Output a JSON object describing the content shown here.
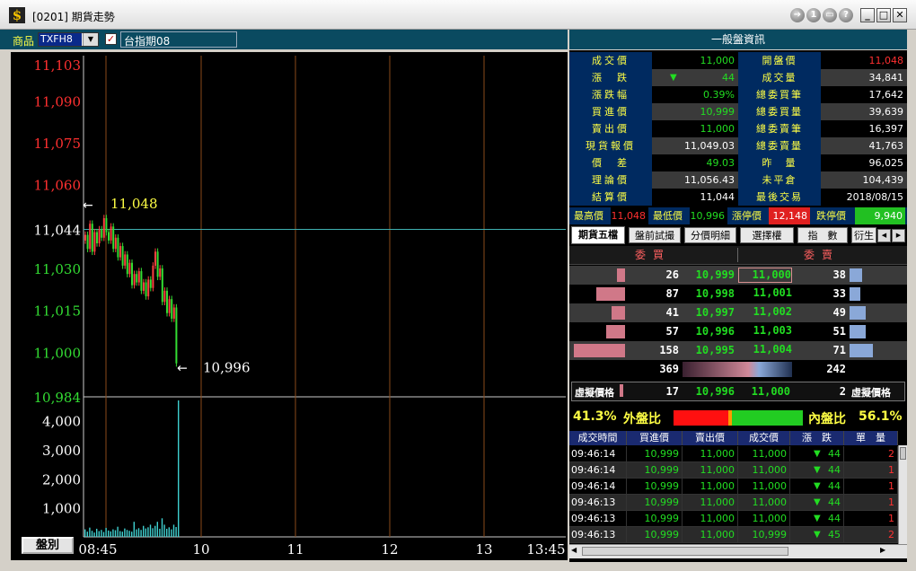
{
  "window": {
    "title": "[0201] 期貨走勢",
    "app_icon_glyph": "$"
  },
  "title_buttons": {
    "help_label": "?",
    "info_label": "1",
    "minimize_label": "_",
    "maximize_label": "□",
    "close_label": "✕"
  },
  "toolbar": {
    "product_label": "商品",
    "product_code": "TXFH8",
    "product_name": "台指期08",
    "panel_title": "一般盤資訊"
  },
  "chart": {
    "price_ticks": [
      "11,103",
      "11,090",
      "11,075",
      "11,060",
      "11,044",
      "11,030",
      "11,015",
      "11,000",
      "10,984"
    ],
    "price_tick_values": [
      11103,
      11090,
      11075,
      11060,
      11044,
      11030,
      11015,
      11000,
      10984
    ],
    "price_tick_colors": [
      "#ff3030",
      "#ff3030",
      "#ff3030",
      "#ff3030",
      "#ffffff",
      "#33dd33",
      "#33dd33",
      "#33dd33",
      "#33dd33"
    ],
    "reference_price": 11044,
    "high_annotation": "11,048",
    "low_annotation": "10,996",
    "high_price": 11048,
    "low_price": 10996,
    "volume_ticks": [
      "4,000",
      "3,000",
      "2,000",
      "1,000"
    ],
    "volume_tick_values": [
      4000,
      3000,
      2000,
      1000
    ],
    "time_ticks": [
      "08:45",
      "10",
      "11",
      "12",
      "13",
      "13:45"
    ],
    "fraction_button": "盤別"
  },
  "quote": {
    "rows": [
      {
        "l1": "成交價",
        "v1": "11,000",
        "c1": "#22dd22",
        "l2": "開盤價",
        "v2": "11,048",
        "c2": "#ff3030"
      },
      {
        "l1": "漲　跌",
        "v1": "44",
        "c1": "#22dd22",
        "l2": "成交量",
        "v2": "34,841",
        "c2": "#ffffff"
      },
      {
        "l1": "漲跌幅",
        "v1": "0.39%",
        "c1": "#22dd22",
        "l2": "總委買筆",
        "v2": "17,642",
        "c2": "#ffffff"
      },
      {
        "l1": "買進價",
        "v1": "10,999",
        "c1": "#22dd22",
        "l2": "總委買量",
        "v2": "39,639",
        "c2": "#ffffff"
      },
      {
        "l1": "賣出價",
        "v1": "11,000",
        "c1": "#22dd22",
        "l2": "總委賣筆",
        "v2": "16,397",
        "c2": "#ffffff"
      },
      {
        "l1": "現貨報價",
        "v1": "11,049.03",
        "c1": "#ffffff",
        "l2": "總委賣量",
        "v2": "41,763",
        "c2": "#ffffff"
      },
      {
        "l1": "價　差",
        "v1": "49.03",
        "c1": "#22dd22",
        "l2": "昨　量",
        "v2": "96,025",
        "c2": "#ffffff"
      },
      {
        "l1": "理論價",
        "v1": "11,056.43",
        "c1": "#ffffff",
        "l2": "未平倉",
        "v2": "104,439",
        "c2": "#ffffff"
      },
      {
        "l1": "結算價",
        "v1": "11,044",
        "c1": "#ffffff",
        "l2": "最後交易",
        "v2": "2018/08/15",
        "c2": "#ffffff"
      }
    ],
    "change_arrow": "▼"
  },
  "limits": {
    "high_label": "最高價",
    "high_value": "11,048",
    "low_label": "最低價",
    "low_value": "10,996",
    "up_label": "漲停價",
    "up_value": "12,148",
    "down_label": "跌停價",
    "down_value": "9,940"
  },
  "tabs": [
    {
      "label": "期貨五檔"
    },
    {
      "label": "盤前試撮"
    },
    {
      "label": "分價明細"
    },
    {
      "label": "選擇權"
    },
    {
      "label": "指　數"
    },
    {
      "label": "衍生"
    }
  ],
  "book": {
    "bid_header": "委買",
    "ask_header": "委賣",
    "levels": [
      {
        "bid_qty": "26",
        "bid": "10,999",
        "ask": "11,000",
        "ask_qty": "38",
        "bid_n": 26,
        "ask_n": 38
      },
      {
        "bid_qty": "87",
        "bid": "10,998",
        "ask": "11,001",
        "ask_qty": "33",
        "bid_n": 87,
        "ask_n": 33
      },
      {
        "bid_qty": "41",
        "bid": "10,997",
        "ask": "11,002",
        "ask_qty": "49",
        "bid_n": 41,
        "ask_n": 49
      },
      {
        "bid_qty": "57",
        "bid": "10,996",
        "ask": "11,003",
        "ask_qty": "51",
        "bid_n": 57,
        "ask_n": 51
      },
      {
        "bid_qty": "158",
        "bid": "10,995",
        "ask": "11,004",
        "ask_qty": "71",
        "bid_n": 158,
        "ask_n": 71
      }
    ],
    "bid_total": "369",
    "ask_total": "242",
    "sim_label_left": "虛擬價格",
    "sim_bid_qty": "17",
    "sim_bid": "10,996",
    "sim_ask": "11,000",
    "sim_ask_qty": "2",
    "sim_label_right": "虛擬價格"
  },
  "ratio": {
    "outer_pct": "41.3%",
    "outer_label": "外盤比",
    "inner_label": "內盤比",
    "inner_pct": "56.1%",
    "outer_value": 41.3,
    "inner_value": 56.1
  },
  "trades": {
    "headers": [
      "成交時間",
      "買進價",
      "賣出價",
      "成交價",
      "漲　跌",
      "單　量"
    ],
    "rows": [
      {
        "time": "09:46:14",
        "bid": "10,999",
        "ask": "11,000",
        "price": "11,000",
        "arrow": "▼",
        "chg": "44",
        "qty": "2"
      },
      {
        "time": "09:46:14",
        "bid": "10,999",
        "ask": "11,000",
        "price": "11,000",
        "arrow": "▼",
        "chg": "44",
        "qty": "1"
      },
      {
        "time": "09:46:14",
        "bid": "10,999",
        "ask": "11,000",
        "price": "11,000",
        "arrow": "▼",
        "chg": "44",
        "qty": "1"
      },
      {
        "time": "09:46:13",
        "bid": "10,999",
        "ask": "11,000",
        "price": "11,000",
        "arrow": "▼",
        "chg": "44",
        "qty": "1"
      },
      {
        "time": "09:46:13",
        "bid": "10,999",
        "ask": "11,000",
        "price": "11,000",
        "arrow": "▼",
        "chg": "44",
        "qty": "1"
      },
      {
        "time": "09:46:13",
        "bid": "10,999",
        "ask": "11,000",
        "price": "10,999",
        "arrow": "▼",
        "chg": "45",
        "qty": "2"
      }
    ]
  },
  "colors": {
    "up": "#ff3030",
    "down": "#22dd22",
    "label_bg": "#002a60",
    "label_text": "#ffff44",
    "bid_bar": "#d07888",
    "ask_bar": "#8aa8d8"
  }
}
